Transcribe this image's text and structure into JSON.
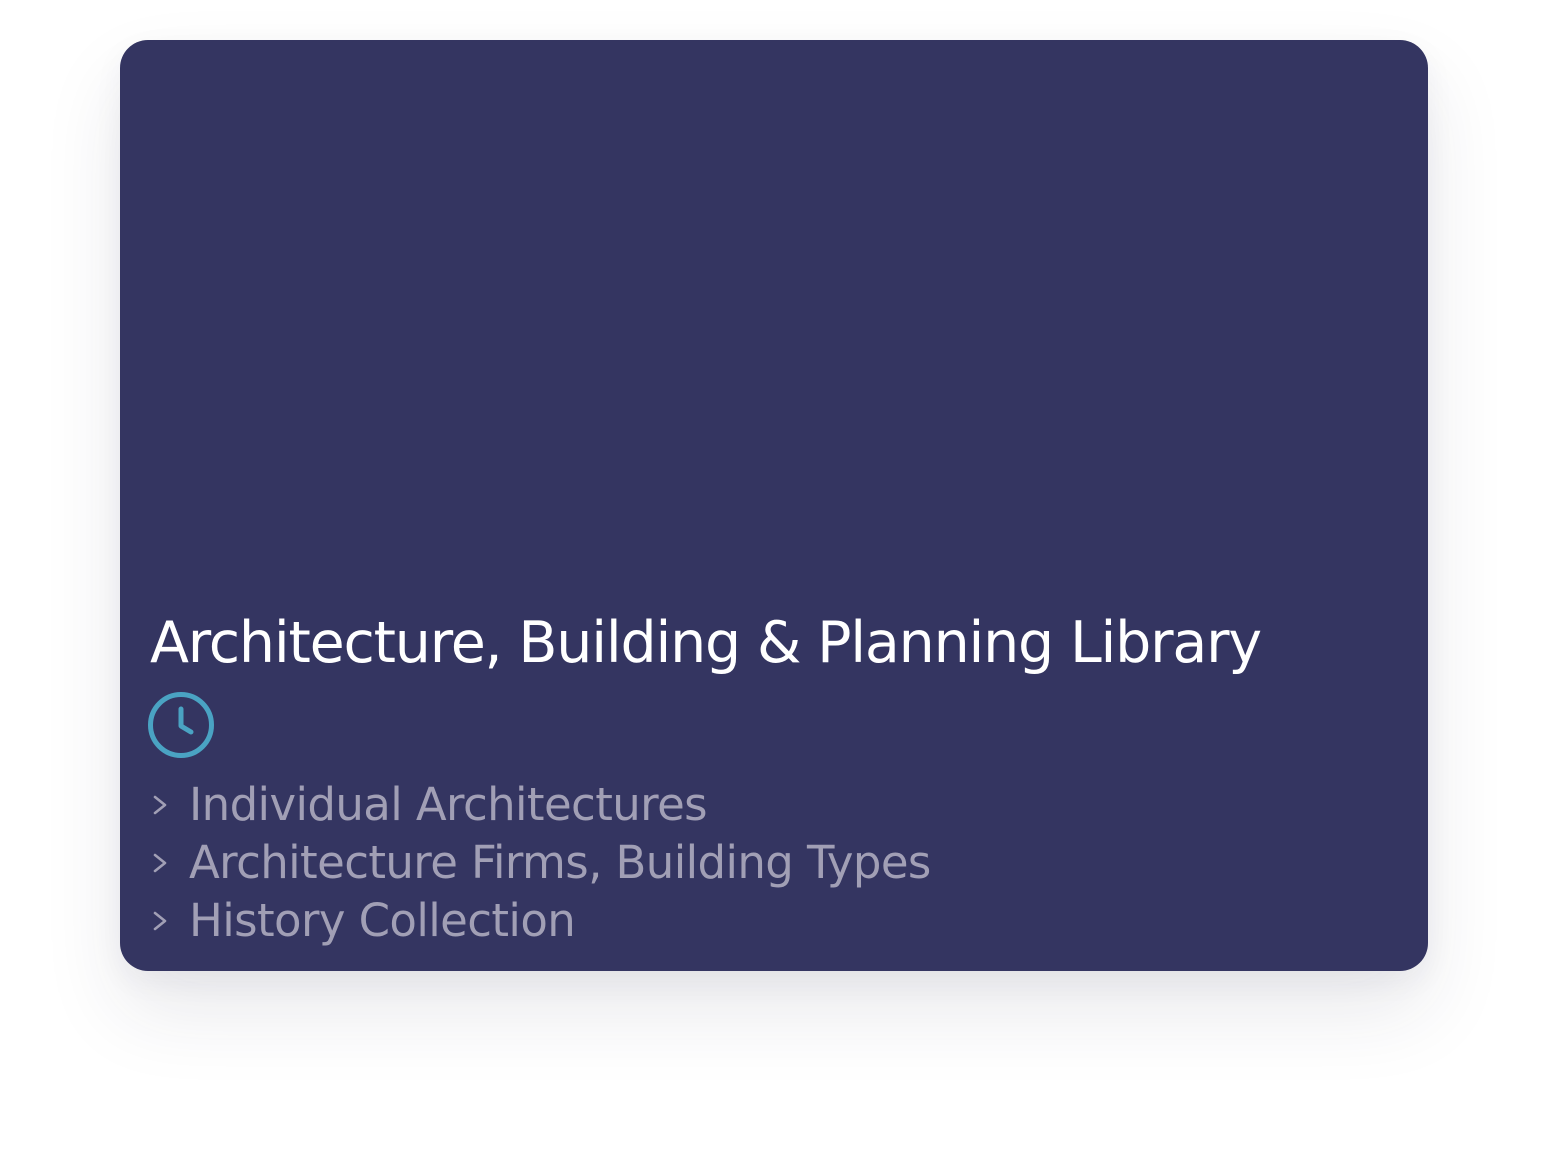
{
  "card": {
    "title": "Architecture, Building & Planning Library",
    "icon": "clock-icon",
    "links": [
      {
        "label": "Individual Architectures",
        "icon": "chevron-right-icon"
      },
      {
        "label": "Architecture Firms, Building Types",
        "icon": "chevron-right-icon"
      },
      {
        "label": "History Collection",
        "icon": "chevron-right-icon"
      }
    ]
  },
  "colors": {
    "card_background": "#343561",
    "title_text": "#ffffff",
    "link_text": "#a19fb5",
    "icon_accent": "#4aa3c3",
    "page_background": "#ffffff"
  }
}
